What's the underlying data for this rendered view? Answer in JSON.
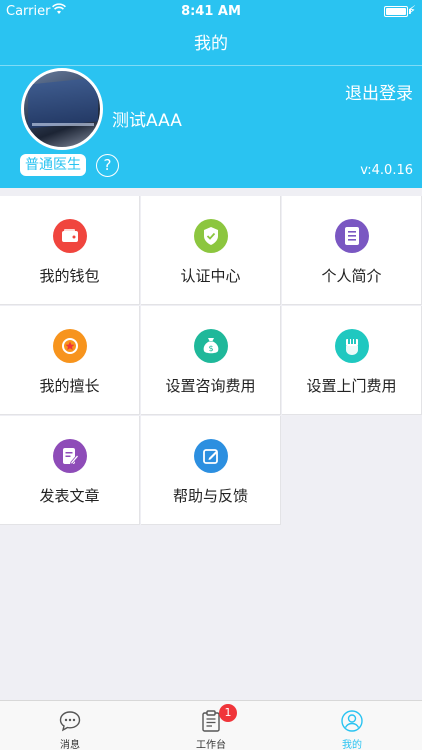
{
  "status_bar": {
    "carrier": "Carrier",
    "time": "8:41 AM"
  },
  "nav": {
    "title": "我的"
  },
  "profile": {
    "username": "测试AAA",
    "logout_label": "退出登录",
    "role": "普通医生",
    "help_symbol": "?",
    "version": "v:4.0.16"
  },
  "menu": [
    {
      "label": "我的钱包",
      "icon": "wallet-icon",
      "color": "#f0453e"
    },
    {
      "label": "认证中心",
      "icon": "shield-check-icon",
      "color": "#8cc63f"
    },
    {
      "label": "个人简介",
      "icon": "document-icon",
      "color": "#7a57c2"
    },
    {
      "label": "我的擅长",
      "icon": "star-badge-icon",
      "color": "#f7941d"
    },
    {
      "label": "设置咨询费用",
      "icon": "money-bag-icon",
      "color": "#1fb89a"
    },
    {
      "label": "设置上门费用",
      "icon": "hand-money-icon",
      "color": "#1fc8c0"
    },
    {
      "label": "发表文章",
      "icon": "edit-document-icon",
      "color": "#8e4cb8"
    },
    {
      "label": "帮助与反馈",
      "icon": "feedback-edit-icon",
      "color": "#2c8fe0"
    }
  ],
  "tabs": [
    {
      "label": "消息",
      "icon": "chat-bubble-icon"
    },
    {
      "label": "工作台",
      "icon": "clipboard-icon",
      "badge": "1"
    },
    {
      "label": "我的",
      "icon": "user-circle-icon"
    }
  ],
  "colors": {
    "brand": "#2ac3f1",
    "badge": "#f0353a"
  }
}
